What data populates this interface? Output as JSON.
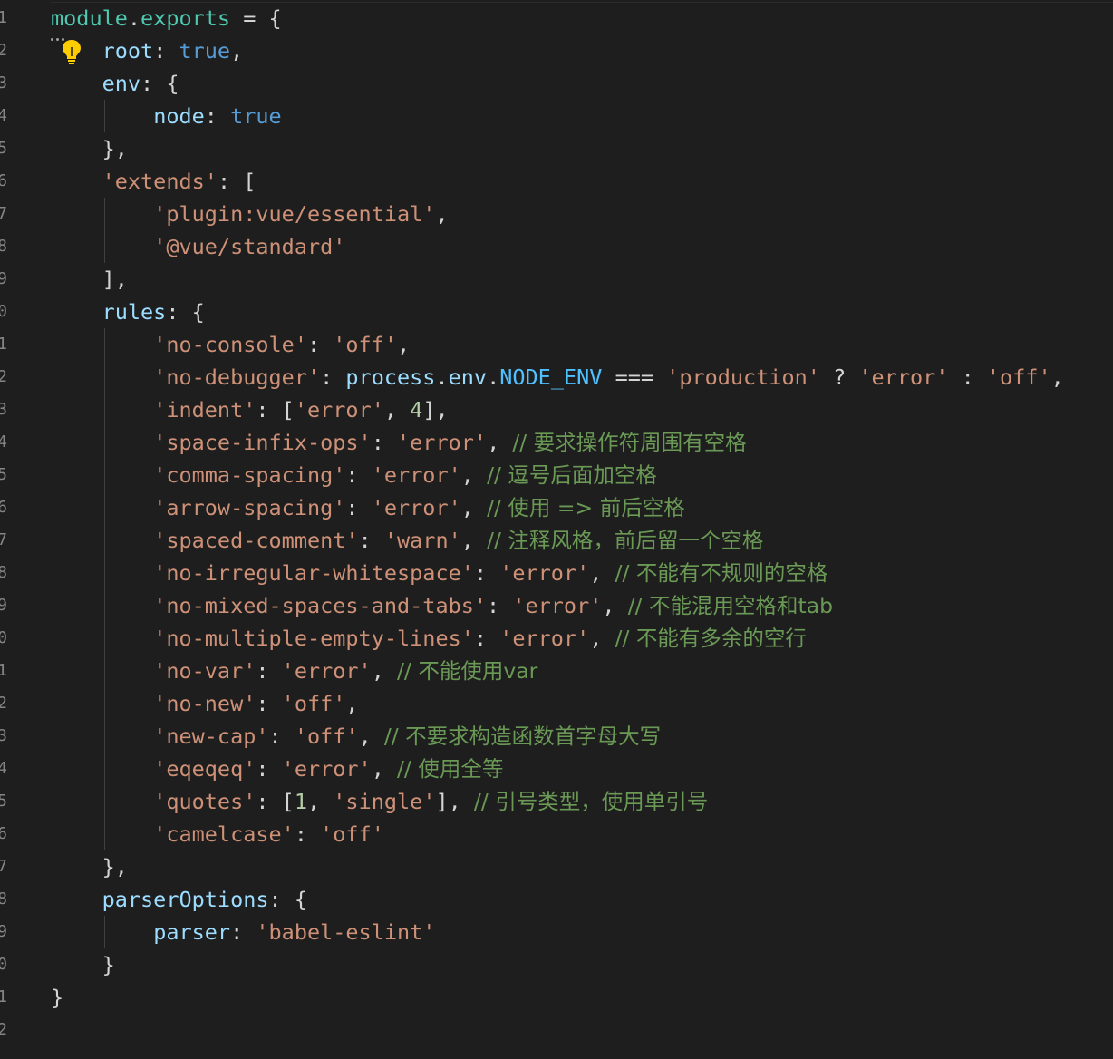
{
  "editor": {
    "theme_colors": {
      "background": "#1e1e1e",
      "property": "#9cdcfe",
      "keyword": "#569cd6",
      "string": "#ce9178",
      "number": "#b5cea8",
      "comment": "#6a9955",
      "constant": "#4fc1ff",
      "module": "#4ec9b0"
    },
    "icons": [
      "lightbulb-icon",
      "ellipsis-icon"
    ],
    "line_numbers": [
      "1",
      "2",
      "3",
      "4",
      "5",
      "6",
      "7",
      "8",
      "9",
      "0",
      "1",
      "2",
      "3",
      "4",
      "5",
      "6",
      "7",
      "8",
      "9",
      "0",
      "1",
      "2",
      "3",
      "4",
      "5",
      "6",
      "7",
      "8",
      "9",
      "0",
      "1",
      "2"
    ],
    "lines": [
      [
        [
          "t-mod",
          "module"
        ],
        [
          "t-punc",
          "."
        ],
        [
          "t-mod",
          "exports"
        ],
        [
          "t-punc",
          " = {"
        ]
      ],
      [
        [
          "t-punc",
          "    "
        ],
        [
          "t-prop",
          "root"
        ],
        [
          "t-punc",
          ": "
        ],
        [
          "t-kw",
          "true"
        ],
        [
          "t-punc",
          ","
        ]
      ],
      [
        [
          "t-punc",
          "    "
        ],
        [
          "t-prop",
          "env"
        ],
        [
          "t-punc",
          ": {"
        ]
      ],
      [
        [
          "t-punc",
          "        "
        ],
        [
          "t-prop",
          "node"
        ],
        [
          "t-punc",
          ": "
        ],
        [
          "t-kw",
          "true"
        ]
      ],
      [
        [
          "t-punc",
          "    },"
        ]
      ],
      [
        [
          "t-punc",
          "    "
        ],
        [
          "t-str",
          "'extends'"
        ],
        [
          "t-punc",
          ": ["
        ]
      ],
      [
        [
          "t-punc",
          "        "
        ],
        [
          "t-str",
          "'plugin:vue/essential'"
        ],
        [
          "t-punc",
          ","
        ]
      ],
      [
        [
          "t-punc",
          "        "
        ],
        [
          "t-str",
          "'@vue/standard'"
        ]
      ],
      [
        [
          "t-punc",
          "    ],"
        ]
      ],
      [
        [
          "t-punc",
          "    "
        ],
        [
          "t-prop",
          "rules"
        ],
        [
          "t-punc",
          ": {"
        ]
      ],
      [
        [
          "t-punc",
          "        "
        ],
        [
          "t-str",
          "'no-console'"
        ],
        [
          "t-punc",
          ": "
        ],
        [
          "t-str",
          "'off'"
        ],
        [
          "t-punc",
          ","
        ]
      ],
      [
        [
          "t-punc",
          "        "
        ],
        [
          "t-str",
          "'no-debugger'"
        ],
        [
          "t-punc",
          ": "
        ],
        [
          "t-prop",
          "process"
        ],
        [
          "t-punc",
          "."
        ],
        [
          "t-prop",
          "env"
        ],
        [
          "t-punc",
          "."
        ],
        [
          "t-const",
          "NODE_ENV"
        ],
        [
          "t-punc",
          " === "
        ],
        [
          "t-str",
          "'production'"
        ],
        [
          "t-punc",
          " ? "
        ],
        [
          "t-str",
          "'error'"
        ],
        [
          "t-punc",
          " : "
        ],
        [
          "t-str",
          "'off'"
        ],
        [
          "t-punc",
          ","
        ]
      ],
      [
        [
          "t-punc",
          "        "
        ],
        [
          "t-str",
          "'indent'"
        ],
        [
          "t-punc",
          ": ["
        ],
        [
          "t-str",
          "'error'"
        ],
        [
          "t-punc",
          ", "
        ],
        [
          "t-num",
          "4"
        ],
        [
          "t-punc",
          "],"
        ]
      ],
      [
        [
          "t-punc",
          "        "
        ],
        [
          "t-str",
          "'space-infix-ops'"
        ],
        [
          "t-punc",
          ": "
        ],
        [
          "t-str",
          "'error'"
        ],
        [
          "t-punc",
          ", "
        ],
        [
          "t-cmt",
          "// 要求操作符周围有空格"
        ]
      ],
      [
        [
          "t-punc",
          "        "
        ],
        [
          "t-str",
          "'comma-spacing'"
        ],
        [
          "t-punc",
          ": "
        ],
        [
          "t-str",
          "'error'"
        ],
        [
          "t-punc",
          ", "
        ],
        [
          "t-cmt",
          "// 逗号后面加空格"
        ]
      ],
      [
        [
          "t-punc",
          "        "
        ],
        [
          "t-str",
          "'arrow-spacing'"
        ],
        [
          "t-punc",
          ": "
        ],
        [
          "t-str",
          "'error'"
        ],
        [
          "t-punc",
          ", "
        ],
        [
          "t-cmt",
          "// 使用 => 前后空格"
        ]
      ],
      [
        [
          "t-punc",
          "        "
        ],
        [
          "t-str",
          "'spaced-comment'"
        ],
        [
          "t-punc",
          ": "
        ],
        [
          "t-str",
          "'warn'"
        ],
        [
          "t-punc",
          ", "
        ],
        [
          "t-cmt",
          "// 注释风格，前后留一个空格"
        ]
      ],
      [
        [
          "t-punc",
          "        "
        ],
        [
          "t-str",
          "'no-irregular-whitespace'"
        ],
        [
          "t-punc",
          ": "
        ],
        [
          "t-str",
          "'error'"
        ],
        [
          "t-punc",
          ", "
        ],
        [
          "t-cmt",
          "// 不能有不规则的空格"
        ]
      ],
      [
        [
          "t-punc",
          "        "
        ],
        [
          "t-str",
          "'no-mixed-spaces-and-tabs'"
        ],
        [
          "t-punc",
          ": "
        ],
        [
          "t-str",
          "'error'"
        ],
        [
          "t-punc",
          ", "
        ],
        [
          "t-cmt",
          "// 不能混用空格和tab"
        ]
      ],
      [
        [
          "t-punc",
          "        "
        ],
        [
          "t-str",
          "'no-multiple-empty-lines'"
        ],
        [
          "t-punc",
          ": "
        ],
        [
          "t-str",
          "'error'"
        ],
        [
          "t-punc",
          ", "
        ],
        [
          "t-cmt",
          "// 不能有多余的空行"
        ]
      ],
      [
        [
          "t-punc",
          "        "
        ],
        [
          "t-str",
          "'no-var'"
        ],
        [
          "t-punc",
          ": "
        ],
        [
          "t-str",
          "'error'"
        ],
        [
          "t-punc",
          ", "
        ],
        [
          "t-cmt",
          "// 不能使用var"
        ]
      ],
      [
        [
          "t-punc",
          "        "
        ],
        [
          "t-str",
          "'no-new'"
        ],
        [
          "t-punc",
          ": "
        ],
        [
          "t-str",
          "'off'"
        ],
        [
          "t-punc",
          ","
        ]
      ],
      [
        [
          "t-punc",
          "        "
        ],
        [
          "t-str",
          "'new-cap'"
        ],
        [
          "t-punc",
          ": "
        ],
        [
          "t-str",
          "'off'"
        ],
        [
          "t-punc",
          ", "
        ],
        [
          "t-cmt",
          "// 不要求构造函数首字母大写"
        ]
      ],
      [
        [
          "t-punc",
          "        "
        ],
        [
          "t-str",
          "'eqeqeq'"
        ],
        [
          "t-punc",
          ": "
        ],
        [
          "t-str",
          "'error'"
        ],
        [
          "t-punc",
          ", "
        ],
        [
          "t-cmt",
          "// 使用全等"
        ]
      ],
      [
        [
          "t-punc",
          "        "
        ],
        [
          "t-str",
          "'quotes'"
        ],
        [
          "t-punc",
          ": ["
        ],
        [
          "t-num",
          "1"
        ],
        [
          "t-punc",
          ", "
        ],
        [
          "t-str",
          "'single'"
        ],
        [
          "t-punc",
          "], "
        ],
        [
          "t-cmt",
          "// 引号类型，使用单引号"
        ]
      ],
      [
        [
          "t-punc",
          "        "
        ],
        [
          "t-str",
          "'camelcase'"
        ],
        [
          "t-punc",
          ": "
        ],
        [
          "t-str",
          "'off'"
        ]
      ],
      [
        [
          "t-punc",
          "    },"
        ]
      ],
      [
        [
          "t-punc",
          "    "
        ],
        [
          "t-prop",
          "parserOptions"
        ],
        [
          "t-punc",
          ": {"
        ]
      ],
      [
        [
          "t-punc",
          "        "
        ],
        [
          "t-prop",
          "parser"
        ],
        [
          "t-punc",
          ": "
        ],
        [
          "t-str",
          "'babel-eslint'"
        ]
      ],
      [
        [
          "t-punc",
          "    }"
        ]
      ],
      [
        [
          "t-punc",
          "}"
        ]
      ]
    ]
  }
}
